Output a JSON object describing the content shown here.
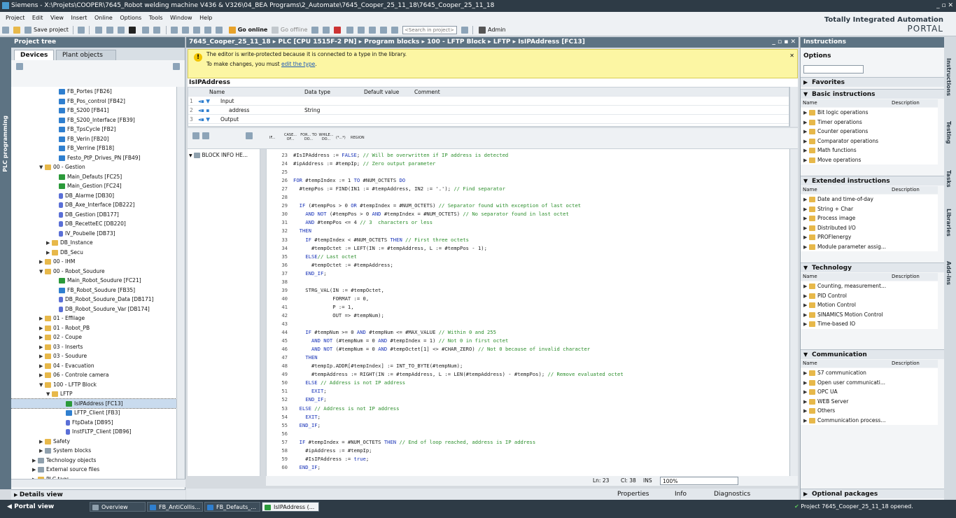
{
  "window": {
    "title": "Siemens  -  X:\\Projets\\COOPER\\7645_Robot welding machine V436 & V326\\04_BEA Programs\\2_Automate\\7645_Cooper_25_11_18\\7645_Cooper_25_11_18"
  },
  "menu": [
    "Project",
    "Edit",
    "View",
    "Insert",
    "Online",
    "Options",
    "Tools",
    "Window",
    "Help"
  ],
  "toolbar": {
    "save_project": "Save project",
    "go_online": "Go online",
    "go_offline": "Go offline",
    "search_placeholder": "<Search in project>",
    "admin": "Admin"
  },
  "brand": {
    "line1": "Totally Integrated Automation",
    "line2": "PORTAL"
  },
  "sidetab": "PLC programming",
  "project_tree": {
    "title": "Project tree",
    "tab_devices": "Devices",
    "tab_plant": "Plant objects",
    "details_view": "Details view",
    "items": [
      {
        "label": "FB_Portes [FB26]",
        "depth": 6,
        "icon": "fb"
      },
      {
        "label": "FB_Pos_control [FB42]",
        "depth": 6,
        "icon": "fb"
      },
      {
        "label": "FB_S200 [FB41]",
        "depth": 6,
        "icon": "fb"
      },
      {
        "label": "FB_S200_Interface [FB39]",
        "depth": 6,
        "icon": "fb"
      },
      {
        "label": "FB_TpsCycle [FB2]",
        "depth": 6,
        "icon": "fb"
      },
      {
        "label": "FB_Verin [FB20]",
        "depth": 6,
        "icon": "fb"
      },
      {
        "label": "FB_Verrine [FB18]",
        "depth": 6,
        "icon": "fb"
      },
      {
        "label": "Festo_PtP_Drives_PN [FB49]",
        "depth": 6,
        "icon": "fb"
      },
      {
        "label": "00 - Gestion",
        "depth": 4,
        "icon": "fold",
        "arrow": "▼"
      },
      {
        "label": "Main_Defauts [FC25]",
        "depth": 6,
        "icon": "ob"
      },
      {
        "label": "Main_Gestion [FC24]",
        "depth": 6,
        "icon": "ob"
      },
      {
        "label": "DB_Alarme [DB30]",
        "depth": 6,
        "icon": "db"
      },
      {
        "label": "DB_Axe_Interface [DB222]",
        "depth": 6,
        "icon": "db"
      },
      {
        "label": "DB_Gestion [DB177]",
        "depth": 6,
        "icon": "db"
      },
      {
        "label": "DB_RecetteEC [DB220]",
        "depth": 6,
        "icon": "db"
      },
      {
        "label": "IV_Poubelle [DB73]",
        "depth": 6,
        "icon": "db"
      },
      {
        "label": "DB_Instance",
        "depth": 5,
        "icon": "fold",
        "arrow": "▶"
      },
      {
        "label": "DB_Secu",
        "depth": 5,
        "icon": "fold",
        "arrow": "▶"
      },
      {
        "label": "00 - IHM",
        "depth": 4,
        "icon": "fold",
        "arrow": "▶"
      },
      {
        "label": "00 - Robot_Soudure",
        "depth": 4,
        "icon": "fold",
        "arrow": "▼"
      },
      {
        "label": "Main_Robot_Soudure [FC21]",
        "depth": 6,
        "icon": "ob"
      },
      {
        "label": "FB_Robot_Soudure [FB35]",
        "depth": 6,
        "icon": "fb"
      },
      {
        "label": "DB_Robot_Soudure_Data [DB171]",
        "depth": 6,
        "icon": "db"
      },
      {
        "label": "DB_Robot_Soudure_Var [DB174]",
        "depth": 6,
        "icon": "db"
      },
      {
        "label": "01 - Effilage",
        "depth": 4,
        "icon": "fold",
        "arrow": "▶"
      },
      {
        "label": "01 - Robot_PB",
        "depth": 4,
        "icon": "fold",
        "arrow": "▶"
      },
      {
        "label": "02 - Coupe",
        "depth": 4,
        "icon": "fold",
        "arrow": "▶"
      },
      {
        "label": "03 - Inserts",
        "depth": 4,
        "icon": "fold",
        "arrow": "▶"
      },
      {
        "label": "03 - Soudure",
        "depth": 4,
        "icon": "fold",
        "arrow": "▶"
      },
      {
        "label": "04 - Evacuation",
        "depth": 4,
        "icon": "fold",
        "arrow": "▶"
      },
      {
        "label": "06 - Controle camera",
        "depth": 4,
        "icon": "fold",
        "arrow": "▶"
      },
      {
        "label": "100 - LFTP Block",
        "depth": 4,
        "icon": "fold",
        "arrow": "▼"
      },
      {
        "label": "LFTP",
        "depth": 5,
        "icon": "fold",
        "arrow": "▼"
      },
      {
        "label": "IsIPAddress [FC13]",
        "depth": 7,
        "icon": "ob",
        "selected": true
      },
      {
        "label": "LFTP_Client [FB3]",
        "depth": 7,
        "icon": "fb"
      },
      {
        "label": "FtpData [DB95]",
        "depth": 7,
        "icon": "db"
      },
      {
        "label": "InstFLTP_Client [DB96]",
        "depth": 7,
        "icon": "db"
      },
      {
        "label": "Safety",
        "depth": 4,
        "icon": "fold",
        "arrow": "▶"
      },
      {
        "label": "System blocks",
        "depth": 4,
        "icon": "sys",
        "arrow": "▶"
      },
      {
        "label": "Technology objects",
        "depth": 3,
        "icon": "sys",
        "arrow": "▶"
      },
      {
        "label": "External source files",
        "depth": 3,
        "icon": "sys",
        "arrow": "▶"
      },
      {
        "label": "PLC tags",
        "depth": 3,
        "icon": "fold",
        "arrow": "▶"
      }
    ]
  },
  "editor": {
    "breadcrumb": "7645_Cooper_25_11_18  ▸  PLC [CPU 1515F-2 PN]  ▸  Program blocks  ▸  100 - LFTP Block  ▸  LFTP  ▸  IsIPAddress [FC13]",
    "warning_line1": "The editor is write-protected because it is connected to a type in the library.",
    "warning_line2": "To make changes, you must ",
    "warning_link": "edit the type",
    "warning_tail": ".",
    "block_name": "IsIPAddress",
    "columns": [
      "Name",
      "Data type",
      "Default value",
      "Comment"
    ],
    "rows": [
      {
        "n": "1",
        "name": "Input",
        "type": ""
      },
      {
        "n": "2",
        "name": "address",
        "type": "String"
      },
      {
        "n": "3",
        "name": "Output",
        "type": ""
      }
    ],
    "instr_buttons": [
      "IF...",
      "CASE... OF...",
      "FOR... TO DO...",
      "WHILE... DO...",
      "(*...*)",
      "REGION"
    ],
    "block_info": "BLOCK INFO HE...",
    "status": {
      "position": "Ln: 23",
      "col": "Cl: 38",
      "mode": "INS",
      "zoom": "100%"
    }
  },
  "code": [
    {
      "n": "23",
      "t": "#IsIPAddress := FALSE; // Will be overwritten if IP address is detected"
    },
    {
      "n": "24",
      "t": "#ipAddress := #tempIp; // Zero output parameter"
    },
    {
      "n": "25",
      "t": ""
    },
    {
      "n": "26",
      "t": "FOR #tempIndex := 1 TO #NUM_OCTETS DO"
    },
    {
      "n": "27",
      "t": "  #tempPos := FIND(IN1 := #tempAddress, IN2 := '.'); // Find separator"
    },
    {
      "n": "28",
      "t": ""
    },
    {
      "n": "29",
      "t": "  IF (#tempPos > 0 OR #tempIndex = #NUM_OCTETS) // Separator found with exception of last octet"
    },
    {
      "n": "30",
      "t": "    AND NOT (#tempPos > 0 AND #tempIndex = #NUM_OCTETS) // No separator found in last octet"
    },
    {
      "n": "31",
      "t": "    AND #tempPos <= 4 // 3  characters or less"
    },
    {
      "n": "32",
      "t": "  THEN"
    },
    {
      "n": "33",
      "t": "    IF #tempIndex < #NUM_OCTETS THEN // First three octets"
    },
    {
      "n": "34",
      "t": "      #tempOctet := LEFT(IN := #tempAddress, L := #tempPos - 1);"
    },
    {
      "n": "35",
      "t": "    ELSE// Last octet"
    },
    {
      "n": "36",
      "t": "      #tempOctet := #tempAddress;"
    },
    {
      "n": "37",
      "t": "    END_IF;"
    },
    {
      "n": "38",
      "t": ""
    },
    {
      "n": "39",
      "t": "    STRG_VAL(IN := #tempOctet,"
    },
    {
      "n": "40",
      "t": "             FORMAT := 0,"
    },
    {
      "n": "41",
      "t": "             P := 1,"
    },
    {
      "n": "42",
      "t": "             OUT => #tempNum);"
    },
    {
      "n": "43",
      "t": ""
    },
    {
      "n": "44",
      "t": "    IF #tempNum >= 0 AND #tempNum <= #MAX_VALUE // Within 0 and 255"
    },
    {
      "n": "45",
      "t": "      AND NOT (#tempNum = 0 AND #tempIndex = 1) // Not 0 in first octet"
    },
    {
      "n": "46",
      "t": "      AND NOT (#tempNum = 0 AND #tempOctet[1] <> #CHAR_ZERO) // Not 0 because of invalid character"
    },
    {
      "n": "47",
      "t": "    THEN"
    },
    {
      "n": "48",
      "t": "      #tempIp.ADDR[#tempIndex] := INT_TO_BYTE(#tempNum);"
    },
    {
      "n": "49",
      "t": "      #tempAddress := RIGHT(IN := #tempAddress, L := LEN(#tempAddress) - #tempPos); // Remove evaluated octet"
    },
    {
      "n": "50",
      "t": "    ELSE // Address is not IP address"
    },
    {
      "n": "51",
      "t": "      EXIT;"
    },
    {
      "n": "52",
      "t": "    END_IF;"
    },
    {
      "n": "53",
      "t": "  ELSE // Address is not IP address"
    },
    {
      "n": "54",
      "t": "    EXIT;"
    },
    {
      "n": "55",
      "t": "  END_IF;"
    },
    {
      "n": "56",
      "t": ""
    },
    {
      "n": "57",
      "t": "  IF #tempIndex = #NUM_OCTETS THEN // End of loop reached, address is IP address"
    },
    {
      "n": "58",
      "t": "    #ipAddress := #tempIp;"
    },
    {
      "n": "59",
      "t": "    #IsIPAddress := true;"
    },
    {
      "n": "60",
      "t": "  END_IF;"
    }
  ],
  "bottom_tabs": {
    "properties": "Properties",
    "info": "Info",
    "diagnostics": "Diagnostics"
  },
  "instructions": {
    "title": "Instructions",
    "options": "Options",
    "favorites": "Favorites",
    "col_name": "Name",
    "col_desc": "Description",
    "basic": {
      "title": "Basic instructions",
      "items": [
        "Bit logic operations",
        "Timer operations",
        "Counter operations",
        "Comparator operations",
        "Math functions",
        "Move operations"
      ]
    },
    "extended": {
      "title": "Extended instructions",
      "items": [
        "Date and time-of-day",
        "String + Char",
        "Process image",
        "Distributed I/O",
        "PROFIenergy",
        "Module parameter assig..."
      ]
    },
    "technology": {
      "title": "Technology",
      "items": [
        "Counting, measurement...",
        "PID Control",
        "Motion Control",
        "SINAMICS Motion Control",
        "Time-based IO"
      ]
    },
    "communication": {
      "title": "Communication",
      "items": [
        "S7 communication",
        "Open user communicati...",
        "OPC UA",
        "WEB Server",
        "Others",
        "Communication process..."
      ]
    },
    "optional": "Optional packages"
  },
  "right_tabs": [
    "Instructions",
    "Testing",
    "Tasks",
    "Libraries",
    "Add-ins"
  ],
  "taskbar": {
    "portal_view": "Portal view",
    "tasks": [
      "Overview",
      "FB_AntiCollis...",
      "FB_Defauts_...",
      "IsIPAddress (..."
    ],
    "message": "Project 7645_Cooper_25_11_18 opened."
  }
}
